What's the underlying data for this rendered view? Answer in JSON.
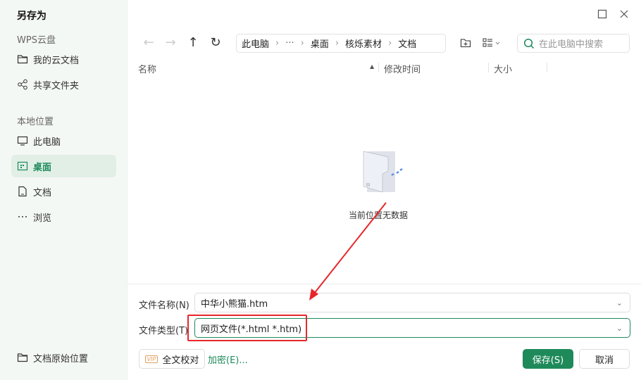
{
  "dialog": {
    "title": "另存为"
  },
  "sidebar": {
    "cloud_section": "WPS云盘",
    "cloud_items": [
      {
        "label": "我的云文档"
      },
      {
        "label": "共享文件夹"
      }
    ],
    "local_section": "本地位置",
    "local_items": [
      {
        "label": "此电脑"
      },
      {
        "label": "桌面"
      },
      {
        "label": "文档"
      },
      {
        "label": "浏览"
      }
    ],
    "bottom_item": "文档原始位置"
  },
  "breadcrumb": [
    "此电脑",
    "···",
    "桌面",
    "核烁素材",
    "文档"
  ],
  "search": {
    "placeholder": "在此电脑中搜索"
  },
  "columns": {
    "name": "名称",
    "modified": "修改时间",
    "size": "大小"
  },
  "empty_text": "当前位置无数据",
  "filename": {
    "label": "文件名称(N)",
    "value": "中华小熊猫.htm"
  },
  "filetype": {
    "label": "文件类型(T)",
    "value": "网页文件(*.html *.htm)"
  },
  "buttons": {
    "vip_badge": "VIP",
    "proofread": "全文校对",
    "encrypt": "加密(E)...",
    "save": "保存(S)",
    "cancel": "取消"
  },
  "colors": {
    "accent": "#1e8a5a",
    "annotation": "#e8262a"
  }
}
